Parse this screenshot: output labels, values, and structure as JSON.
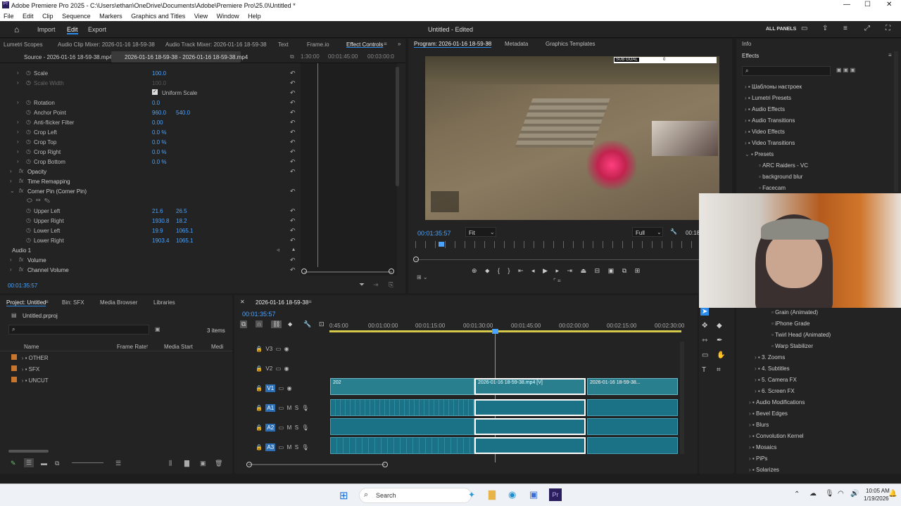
{
  "window": {
    "title": "Adobe Premiere Pro 2025 - C:\\Users\\ethan\\OneDrive\\Documents\\Adobe\\Premiere Pro\\25.0\\Untitled *"
  },
  "menu": [
    "File",
    "Edit",
    "Clip",
    "Sequence",
    "Markers",
    "Graphics and Titles",
    "View",
    "Window",
    "Help"
  ],
  "header": {
    "nav": [
      "Import",
      "Edit",
      "Export"
    ],
    "project": "Untitled - Edited",
    "all_panels": "ALL PANELS"
  },
  "top_tabs": {
    "lumetri": "Lumetri Scopes",
    "audio_clip": "Audio Clip Mixer: 2026-01-16 18-59-38",
    "audio_track": "Audio Track Mixer: 2026-01-16 18-59-38",
    "text": "Text",
    "frameio": "Frame.io",
    "effect_controls": "Effect Controls"
  },
  "ec": {
    "source": "Source - 2026-01-16 18-59-38.mp4",
    "clip": "2026-01-16 18-59-38 - 2026-01-16 18-59-38.mp4",
    "ruler": [
      "1:30:00",
      "00:01:45:00",
      "00:03:00:0"
    ],
    "uniform": "Uniform Scale",
    "props": [
      {
        "name": "Scale",
        "v1": "100.0",
        "v2": ""
      },
      {
        "name": "Scale Width",
        "v1": "100.0",
        "v2": ""
      },
      {
        "name": "Rotation",
        "v1": "0.0",
        "v2": ""
      },
      {
        "name": "Anchor Point",
        "v1": "960.0",
        "v2": "540.0"
      },
      {
        "name": "Anti-flicker Filter",
        "v1": "0.00",
        "v2": ""
      },
      {
        "name": "Crop Left",
        "v1": "0.0 %",
        "v2": ""
      },
      {
        "name": "Crop Top",
        "v1": "0.0 %",
        "v2": ""
      },
      {
        "name": "Crop Right",
        "v1": "0.0 %",
        "v2": ""
      },
      {
        "name": "Crop Bottom",
        "v1": "0.0 %",
        "v2": ""
      }
    ],
    "sections": [
      "Opacity",
      "Time Remapping",
      "Corner Pin (Corner Pin)"
    ],
    "corner": [
      {
        "name": "Upper Left",
        "v1": "21.6",
        "v2": "26.5"
      },
      {
        "name": "Upper Right",
        "v1": "1930.8",
        "v2": "18.2"
      },
      {
        "name": "Lower Left",
        "v1": "19.9",
        "v2": "1065.1"
      },
      {
        "name": "Lower Right",
        "v1": "1903.4",
        "v2": "1065.1"
      }
    ],
    "audio": "Audio 1",
    "audio_sections": [
      "Volume",
      "Channel Volume"
    ],
    "timecode": "00:01:35:57"
  },
  "program": {
    "tabs": [
      "Program: 2026-01-16 18-59-38",
      "Metadata",
      "Graphics Templates"
    ],
    "timecode": "00:01:35:57",
    "fit": "Fit",
    "full": "Full",
    "end": "00:18",
    "hud": "SUB GOAL",
    "hud_val": "0"
  },
  "info": {
    "tab": "Info",
    "effects": "Effects"
  },
  "effects_tree": [
    "Шаблоны настроек",
    "Lumetri Presets",
    "Audio Effects",
    "Audio Transitions",
    "Video Effects",
    "Video Transitions",
    "Presets",
    "ARC Raiders - VC",
    "background blur",
    "Facecam"
  ],
  "effects_tree2": [
    "Grain (Animated)",
    "iPhone Grade",
    "Twirl Head (Animated)",
    "Warp Stabilizer",
    "3. Zooms",
    "4. Subtitles",
    "5. Camera FX",
    "6. Screen FX",
    "Audio Modifications",
    "Bevel Edges",
    "Blurs",
    "Convolution Kernel",
    "Mosaics",
    "PiPs",
    "Solarizes"
  ],
  "project": {
    "tabs": [
      "Project: Untitled",
      "Bin: SFX",
      "Media Browser",
      "Libraries"
    ],
    "file": "Untitled.prproj",
    "items": "3 items",
    "cols": [
      "Name",
      "Frame Rate",
      "Media Start",
      "Medi"
    ],
    "bins": [
      "OTHER",
      "SFX",
      "UNCUT"
    ],
    "colors": {
      "bin": "#c8762f"
    }
  },
  "timeline": {
    "tab": "2026-01-16 18-59-38",
    "timecode": "00:01:35:57",
    "ruler": [
      "0:45:00",
      "00:01:00:00",
      "00:01:15:00",
      "00:01:30:00",
      "00:01:45:00",
      "00:02:00:00",
      "00:02:15:00",
      "00:02:30:00"
    ],
    "tracks": [
      "V3",
      "V2",
      "V1",
      "A1",
      "A2",
      "A3"
    ],
    "clips": {
      "c1": "202",
      "c2": "2026-01-16 18-59-38.mp4 [V]",
      "c3": "2026-01-16 18-59-38..."
    }
  },
  "taskbar": {
    "search": "Search",
    "time": "10:05 AM",
    "date": "1/19/2026"
  },
  "colors": {
    "accent": "#2d8ceb",
    "clip": "#2a7f8f",
    "audio": "#1b7185"
  }
}
